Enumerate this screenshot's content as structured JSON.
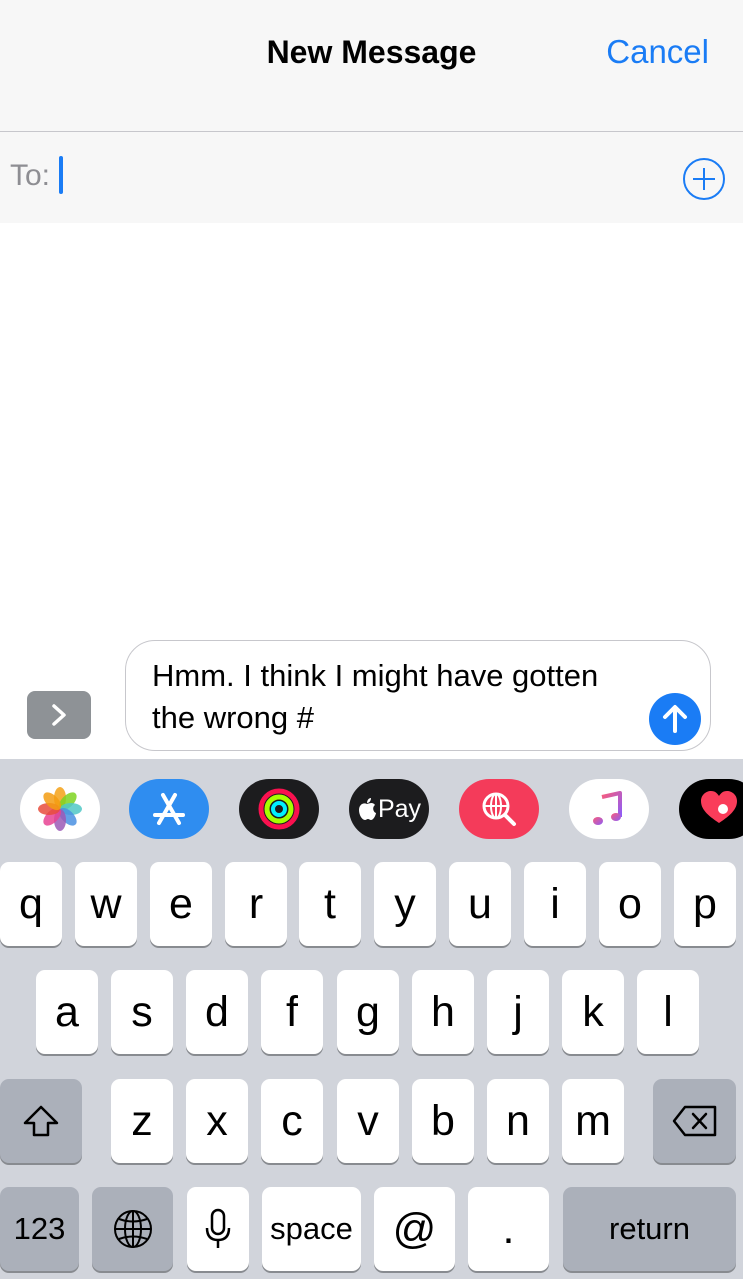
{
  "nav": {
    "title": "New Message",
    "cancel_label": "Cancel"
  },
  "to_field": {
    "label": "To:",
    "value": ""
  },
  "compose": {
    "message_text": "Hmm. I think I might have gotten the wrong #"
  },
  "app_drawer": {
    "apps": [
      "photos-icon",
      "app-store-icon",
      "activity-icon",
      "apple-pay-icon",
      "web-images-icon",
      "music-icon",
      "digital-touch-icon"
    ],
    "apple_pay_label": "Pay"
  },
  "keyboard": {
    "row1": [
      "q",
      "w",
      "e",
      "r",
      "t",
      "y",
      "u",
      "i",
      "o",
      "p"
    ],
    "row2": [
      "a",
      "s",
      "d",
      "f",
      "g",
      "h",
      "j",
      "k",
      "l"
    ],
    "row3": [
      "z",
      "x",
      "c",
      "v",
      "b",
      "n",
      "m"
    ],
    "numbers_label": "123",
    "space_label": "space",
    "at_label": "@",
    "period_label": ".",
    "return_label": "return"
  },
  "colors": {
    "accent": "#1a7cf5",
    "key_bg": "#ffffff",
    "keyboard_bg": "#d1d4db",
    "function_key_bg": "#abb0ba"
  }
}
